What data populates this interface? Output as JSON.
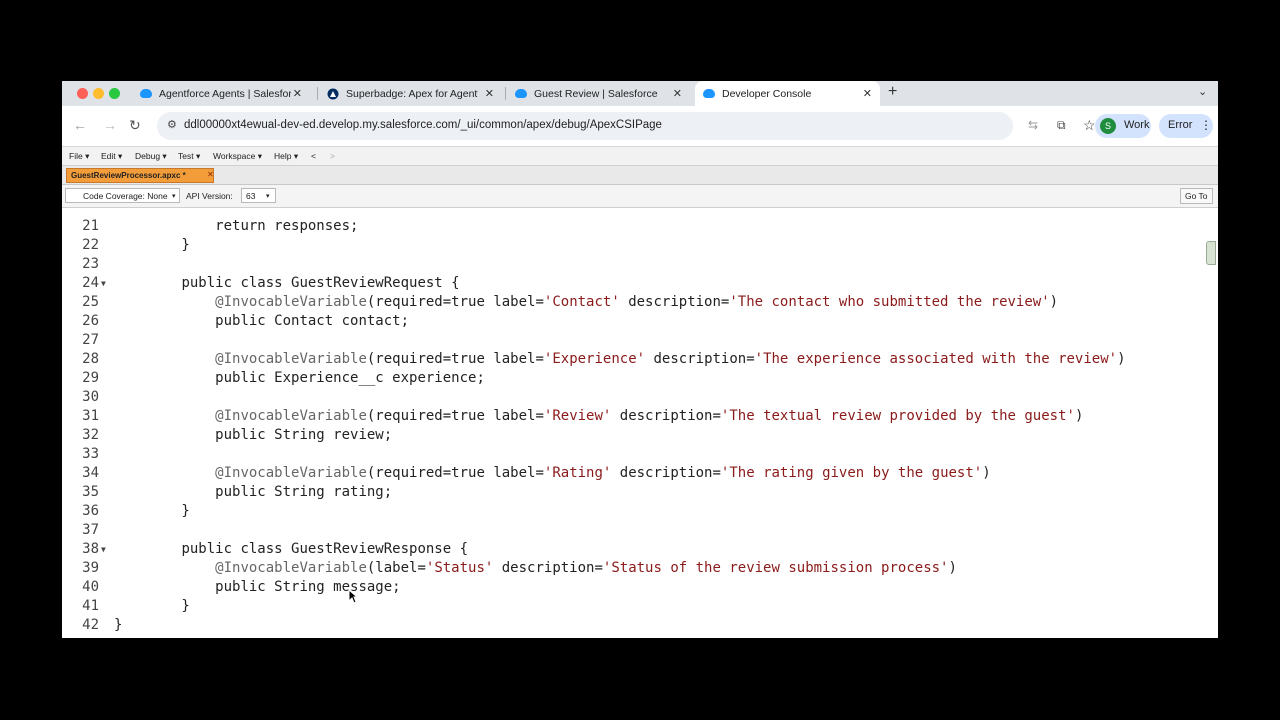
{
  "browser": {
    "tabs": [
      {
        "title": "Agentforce Agents | Salesforce",
        "icon": "salesforce-cloud-icon",
        "active": false
      },
      {
        "title": "Superbadge: Apex for Agentforce",
        "icon": "trailhead-icon",
        "active": false
      },
      {
        "title": "Guest Review | Salesforce",
        "icon": "salesforce-cloud-icon",
        "active": false
      },
      {
        "title": "Developer Console",
        "icon": "salesforce-cloud-icon",
        "active": true
      }
    ],
    "url": "ddl00000xt4ewual-dev-ed.develop.my.salesforce.com/_ui/common/apex/debug/ApexCSIPage",
    "profile_initial": "S",
    "profile_label": "Work",
    "error_label": "Error"
  },
  "console": {
    "menus": [
      {
        "label": "File"
      },
      {
        "label": "Edit"
      },
      {
        "label": "Debug"
      },
      {
        "label": "Test"
      },
      {
        "label": "Workspace"
      },
      {
        "label": "Help"
      }
    ],
    "file_tab": "GuestReviewProcessor.apxc *",
    "code_coverage": "Code Coverage: None",
    "api_label": "API Version:",
    "api_version": "63",
    "goto_label": "Go To"
  },
  "colors": {
    "active_file_tab": "#f39c3a",
    "string_literal": "#8b1a1a",
    "annotation": "#666666",
    "profile_avatar": "#1e8e3e"
  },
  "code_lines": [
    {
      "num": "21",
      "fold": false,
      "tokens": [
        {
          "t": "            "
        },
        {
          "t": "return",
          "c": "kw"
        },
        {
          "t": " responses;"
        }
      ]
    },
    {
      "num": "22",
      "fold": false,
      "tokens": [
        {
          "t": "        }"
        }
      ]
    },
    {
      "num": "23",
      "fold": false,
      "tokens": []
    },
    {
      "num": "24",
      "fold": true,
      "tokens": [
        {
          "t": "        "
        },
        {
          "t": "public class",
          "c": "kw"
        },
        {
          "t": " GuestReviewRequest {"
        }
      ]
    },
    {
      "num": "25",
      "fold": false,
      "tokens": [
        {
          "t": "            "
        },
        {
          "t": "@InvocableVariable",
          "c": "an"
        },
        {
          "t": "(required="
        },
        {
          "t": "true",
          "c": "kw"
        },
        {
          "t": " label="
        },
        {
          "t": "'Contact'",
          "c": "st"
        },
        {
          "t": " description="
        },
        {
          "t": "'The contact who submitted the review'",
          "c": "st"
        },
        {
          "t": ")"
        }
      ]
    },
    {
      "num": "26",
      "fold": false,
      "tokens": [
        {
          "t": "            "
        },
        {
          "t": "public",
          "c": "kw"
        },
        {
          "t": " Contact contact;"
        }
      ]
    },
    {
      "num": "27",
      "fold": false,
      "tokens": []
    },
    {
      "num": "28",
      "fold": false,
      "tokens": [
        {
          "t": "            "
        },
        {
          "t": "@InvocableVariable",
          "c": "an"
        },
        {
          "t": "(required="
        },
        {
          "t": "true",
          "c": "kw"
        },
        {
          "t": " label="
        },
        {
          "t": "'Experience'",
          "c": "st"
        },
        {
          "t": " description="
        },
        {
          "t": "'The experience associated with the review'",
          "c": "st"
        },
        {
          "t": ")"
        }
      ]
    },
    {
      "num": "29",
      "fold": false,
      "tokens": [
        {
          "t": "            "
        },
        {
          "t": "public",
          "c": "kw"
        },
        {
          "t": " Experience__c experience;"
        }
      ]
    },
    {
      "num": "30",
      "fold": false,
      "tokens": []
    },
    {
      "num": "31",
      "fold": false,
      "tokens": [
        {
          "t": "            "
        },
        {
          "t": "@InvocableVariable",
          "c": "an"
        },
        {
          "t": "(required="
        },
        {
          "t": "true",
          "c": "kw"
        },
        {
          "t": " label="
        },
        {
          "t": "'Review'",
          "c": "st"
        },
        {
          "t": " description="
        },
        {
          "t": "'The textual review provided by the guest'",
          "c": "st"
        },
        {
          "t": ")"
        }
      ]
    },
    {
      "num": "32",
      "fold": false,
      "tokens": [
        {
          "t": "            "
        },
        {
          "t": "public",
          "c": "kw"
        },
        {
          "t": " String review;"
        }
      ]
    },
    {
      "num": "33",
      "fold": false,
      "tokens": []
    },
    {
      "num": "34",
      "fold": false,
      "tokens": [
        {
          "t": "            "
        },
        {
          "t": "@InvocableVariable",
          "c": "an"
        },
        {
          "t": "(required="
        },
        {
          "t": "true",
          "c": "kw"
        },
        {
          "t": " label="
        },
        {
          "t": "'Rating'",
          "c": "st"
        },
        {
          "t": " description="
        },
        {
          "t": "'The rating given by the guest'",
          "c": "st"
        },
        {
          "t": ")"
        }
      ]
    },
    {
      "num": "35",
      "fold": false,
      "tokens": [
        {
          "t": "            "
        },
        {
          "t": "public",
          "c": "kw"
        },
        {
          "t": " String rating;"
        }
      ]
    },
    {
      "num": "36",
      "fold": false,
      "tokens": [
        {
          "t": "        }"
        }
      ]
    },
    {
      "num": "37",
      "fold": false,
      "tokens": []
    },
    {
      "num": "38",
      "fold": true,
      "tokens": [
        {
          "t": "        "
        },
        {
          "t": "public class",
          "c": "kw"
        },
        {
          "t": " GuestReviewResponse {"
        }
      ]
    },
    {
      "num": "39",
      "fold": false,
      "tokens": [
        {
          "t": "            "
        },
        {
          "t": "@InvocableVariable",
          "c": "an"
        },
        {
          "t": "(label="
        },
        {
          "t": "'Status'",
          "c": "st"
        },
        {
          "t": " description="
        },
        {
          "t": "'Status of the review submission process'",
          "c": "st"
        },
        {
          "t": ")"
        }
      ]
    },
    {
      "num": "40",
      "fold": false,
      "tokens": [
        {
          "t": "            "
        },
        {
          "t": "public",
          "c": "kw"
        },
        {
          "t": " String message;"
        }
      ]
    },
    {
      "num": "41",
      "fold": false,
      "tokens": [
        {
          "t": "        }"
        }
      ]
    },
    {
      "num": "42",
      "fold": false,
      "tokens": [
        {
          "t": "}"
        }
      ]
    }
  ]
}
